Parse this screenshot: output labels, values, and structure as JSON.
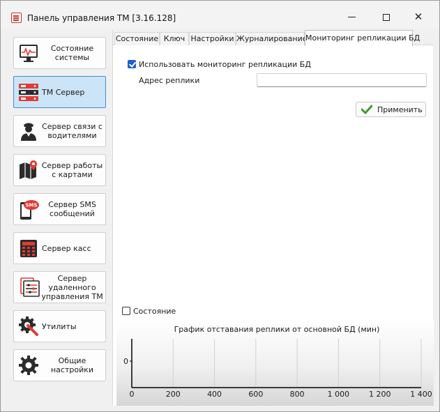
{
  "window": {
    "title": "Панель управления ТМ [3.16.128]",
    "close_glyph": "✕"
  },
  "sidebar": {
    "items": [
      {
        "label": "Состояние системы",
        "icon": "monitor-icon"
      },
      {
        "label": "ТМ Сервер",
        "icon": "server-icon",
        "active": true
      },
      {
        "label": "Сервер связи с водителями",
        "icon": "driver-icon"
      },
      {
        "label": "Сервер работы с картами",
        "icon": "map-icon"
      },
      {
        "label": "Сервер SMS сообщений",
        "icon": "sms-icon",
        "badge": "SMS"
      },
      {
        "label": "Сервер касс",
        "icon": "cash-register-icon"
      },
      {
        "label": "Сервер удаленного управления ТМ",
        "icon": "remote-control-icon"
      },
      {
        "label": "Утилиты",
        "icon": "wrench-gear-icon"
      },
      {
        "label": "Общие настройки",
        "icon": "gear-icon"
      }
    ]
  },
  "tabs": [
    {
      "label": "Состояние"
    },
    {
      "label": "Ключ"
    },
    {
      "label": "Настройки"
    },
    {
      "label": "Журналирование"
    },
    {
      "label": "Мониторинг репликации БД",
      "active": true
    }
  ],
  "replication": {
    "enable_label": "Использовать мониторинг репликации БД",
    "enable_checked": true,
    "address_label": "Адрес реплики",
    "address_value": "",
    "apply_label": "Применить",
    "state_label": "Состояние",
    "state_checked": false
  },
  "chart_data": {
    "type": "line",
    "title": "График отставания реплики от основной БД (мин)",
    "x_ticks": [
      "0",
      "200",
      "400",
      "600",
      "800",
      "1 000",
      "1 200",
      "1 400"
    ],
    "x_tick_values": [
      0,
      200,
      400,
      600,
      800,
      1000,
      1200,
      1400
    ],
    "y_ticks": [
      "0"
    ],
    "y_tick_values": [
      0
    ],
    "xlim": [
      0,
      1400
    ],
    "series": [],
    "grid": true,
    "legend": "none"
  },
  "colors": {
    "accent": "#1b62c9",
    "active_nav_bg": "#cce4f7",
    "active_nav_border": "#3d8edb",
    "icon_red": "#e03b34",
    "icon_dark": "#2b2b2b",
    "apply_check": "#3e9a2c"
  }
}
